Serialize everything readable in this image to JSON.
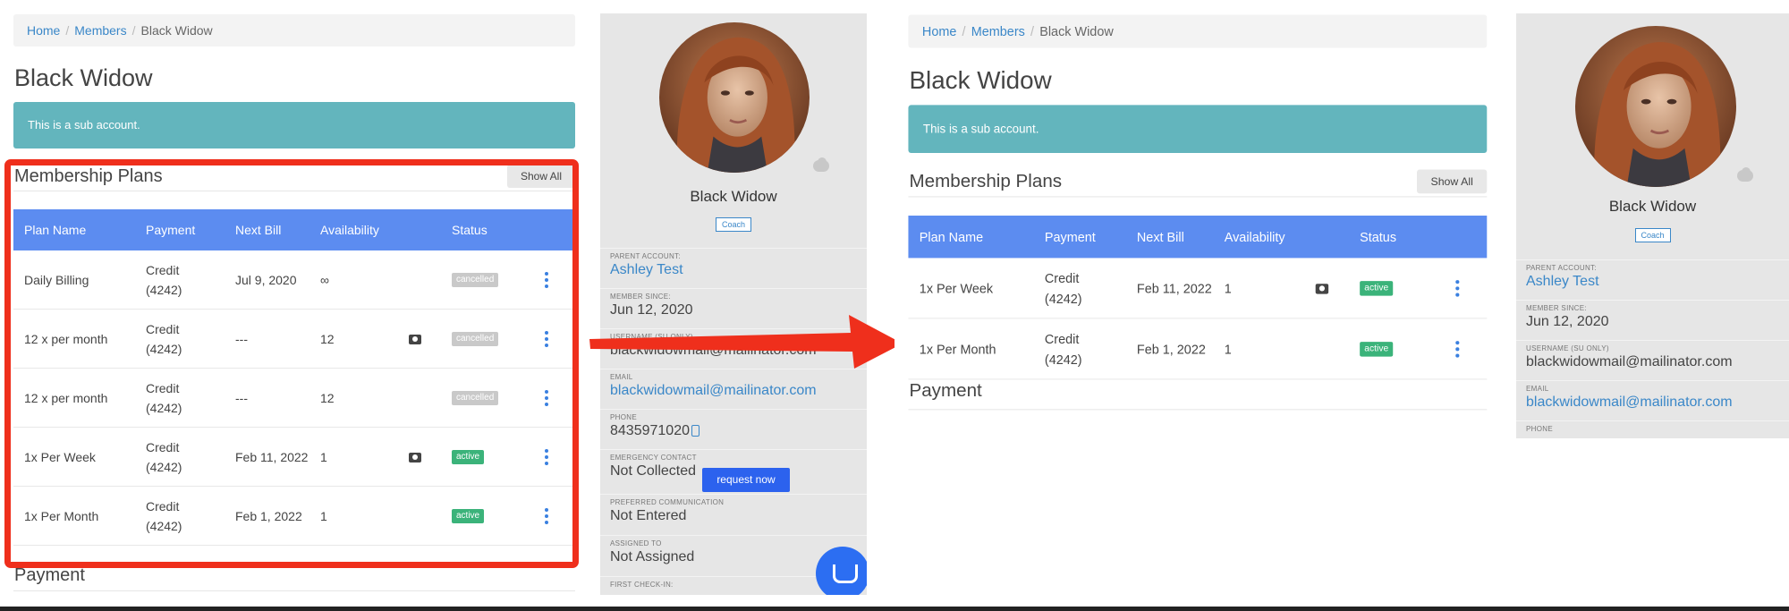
{
  "breadcrumb": {
    "home": "Home",
    "members": "Members",
    "current": "Black Widow"
  },
  "page": {
    "title": "Black Widow",
    "alert": "This is a sub account."
  },
  "membership": {
    "title": "Membership Plans",
    "show_all": "Show All",
    "columns": [
      "Plan Name",
      "Payment",
      "Next Bill",
      "Availability",
      "Status"
    ],
    "rows_before": [
      {
        "plan": "Daily Billing",
        "payment": "Credit (4242)",
        "next_bill": "Jul 9, 2020",
        "availability": "∞",
        "camera": false,
        "status": "cancelled"
      },
      {
        "plan": "12 x per month",
        "payment": "Credit (4242)",
        "next_bill": "---",
        "availability": "12",
        "camera": true,
        "status": "cancelled"
      },
      {
        "plan": "12 x per month",
        "payment": "Credit (4242)",
        "next_bill": "---",
        "availability": "12",
        "camera": false,
        "status": "cancelled"
      },
      {
        "plan": "1x Per Week",
        "payment": "Credit (4242)",
        "next_bill": "Feb 11, 2022",
        "availability": "1",
        "camera": true,
        "status": "active"
      },
      {
        "plan": "1x Per Month",
        "payment": "Credit (4242)",
        "next_bill": "Feb 1, 2022",
        "availability": "1",
        "camera": false,
        "status": "active"
      }
    ],
    "rows_after": [
      {
        "plan": "1x Per Week",
        "payment": "Credit (4242)",
        "next_bill": "Feb 11, 2022",
        "availability": "1",
        "camera": true,
        "status": "active"
      },
      {
        "plan": "1x Per Month",
        "payment": "Credit (4242)",
        "next_bill": "Feb 1, 2022",
        "availability": "1",
        "camera": false,
        "status": "active"
      }
    ]
  },
  "payment": {
    "title": "Payment"
  },
  "profile": {
    "name": "Black Widow",
    "role": "Coach",
    "fields": {
      "parent_label": "PARENT ACCOUNT:",
      "parent_value": "Ashley Test",
      "since_label": "MEMBER SINCE:",
      "since_value": "Jun 12, 2020",
      "username_label": "USERNAME (SU ONLY)",
      "username_value": "blackwidowmail@mailinator.com",
      "email_label": "EMAIL",
      "email_value": "blackwidowmail@mailinator.com",
      "phone_label": "PHONE",
      "phone_value": "8435971020",
      "emergency_label": "EMERGENCY CONTACT",
      "emergency_value": "Not Collected",
      "request_button": "request now",
      "comm_label": "PREFERRED COMMUNICATION",
      "comm_value": "Not Entered",
      "assigned_label": "ASSIGNED TO",
      "assigned_value": "Not Assigned",
      "checkin_label": "FIRST CHECK-IN:"
    }
  },
  "colors": {
    "table_header": "#5c8cf0",
    "alert": "#63b5bd",
    "highlight": "#ef2f1c",
    "active": "#3bb37a",
    "cancelled": "#c9c9c9",
    "link": "#3a87c8"
  }
}
